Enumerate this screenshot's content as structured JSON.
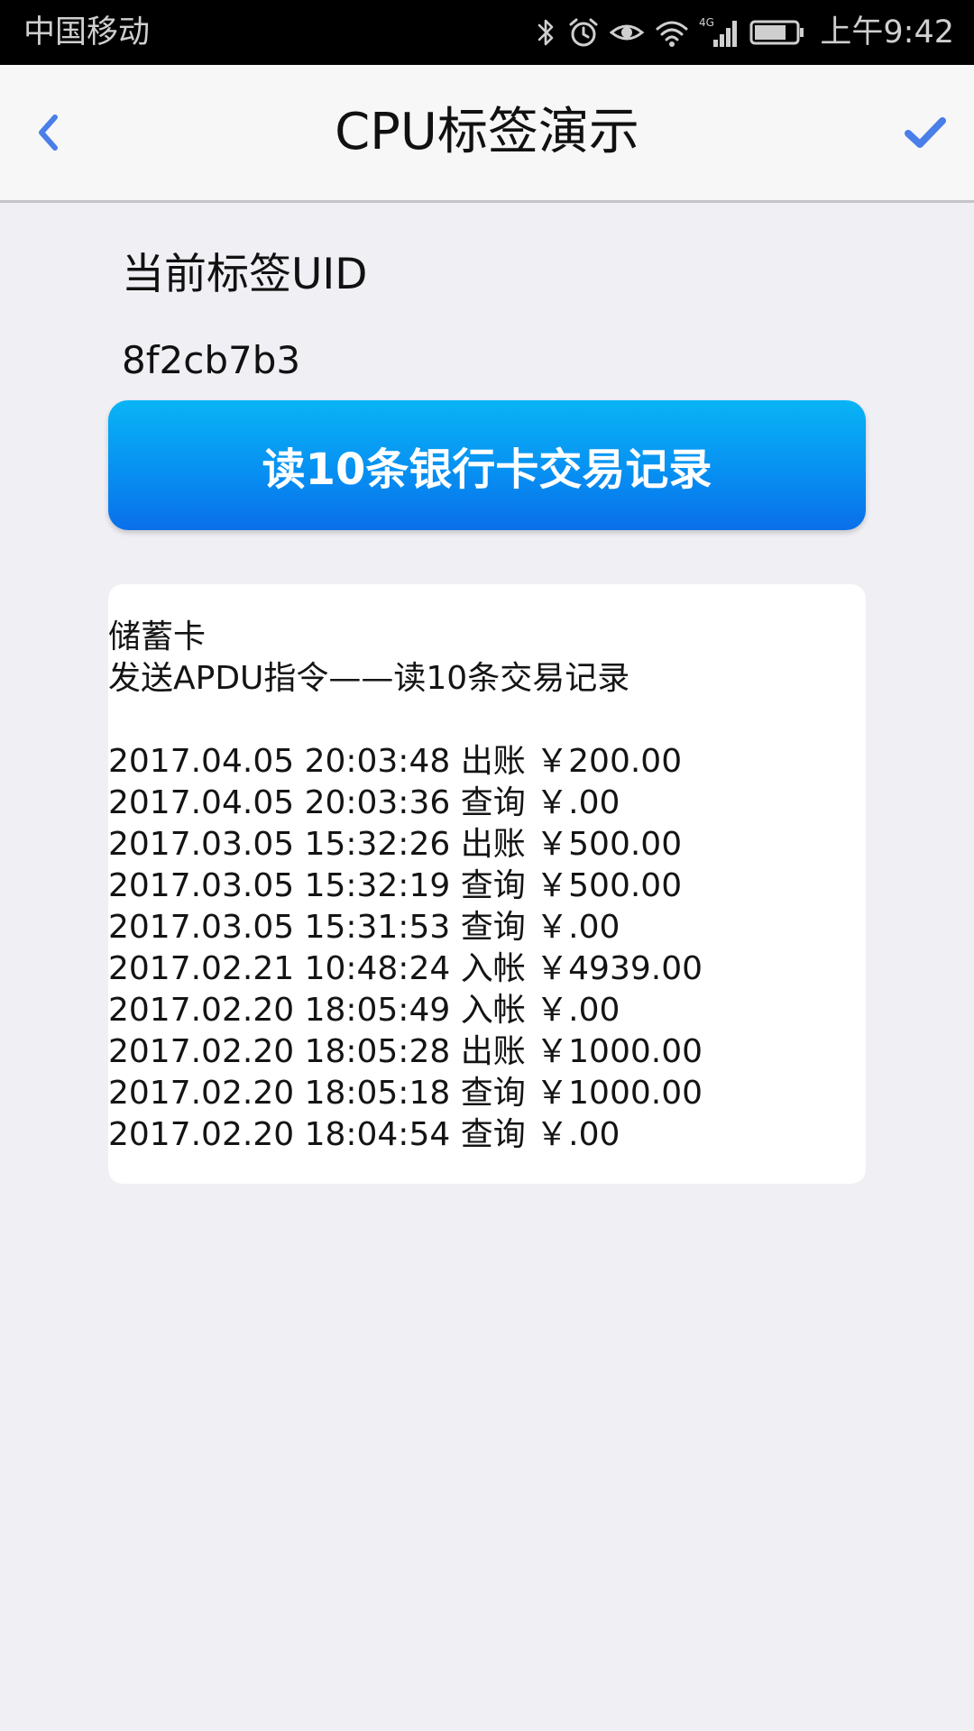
{
  "status_bar": {
    "carrier": "中国移动",
    "network": "4G",
    "time": "上午9:42"
  },
  "header": {
    "title": "CPU标签演示",
    "back_icon": "chevron-left-icon",
    "confirm_icon": "checkmark-icon",
    "accent_color": "#4a7ee8"
  },
  "tag": {
    "uid_label": "当前标签UID",
    "uid_value": "8f2cb7b3"
  },
  "read_button": {
    "label": "读10条银行卡交易记录",
    "color": "#0790f2"
  },
  "result": {
    "card_type": "储蓄卡",
    "command": "发送APDU指令——读10条交易记录",
    "records": [
      "2017.04.05 20:03:48 出账 ￥200.00",
      "2017.04.05 20:03:36 查询 ￥.00",
      "2017.03.05 15:32:26 出账 ￥500.00",
      "2017.03.05 15:32:19 查询 ￥500.00",
      "2017.03.05 15:31:53 查询 ￥.00",
      "2017.02.21 10:48:24 入帐 ￥4939.00",
      "2017.02.20 18:05:49 入帐 ￥.00",
      "2017.02.20 18:05:28 出账 ￥1000.00",
      "2017.02.20 18:05:18 查询 ￥1000.00",
      "2017.02.20 18:04:54 查询 ￥.00"
    ]
  }
}
